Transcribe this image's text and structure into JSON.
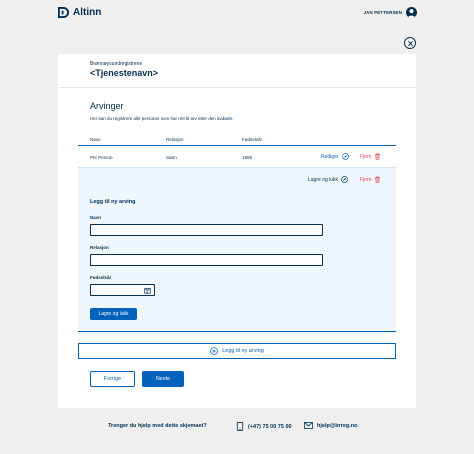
{
  "header": {
    "logo_text": "Altinn",
    "user_name": "JAN PETTERSEN"
  },
  "form": {
    "org_name": "Brønnøysundregistrene",
    "service_name": "<Tjenestenavn>",
    "section_title": "Arvinger",
    "section_description": "Her kan du registrere alle personer som har rett til arv etter den avdøde."
  },
  "table": {
    "columns": [
      "Navn",
      "Relasjon",
      "Fødselsår"
    ],
    "rows": [
      {
        "navn": "Per Person",
        "relasjon": "Sønn",
        "fodselsar": "1968",
        "edit_label": "Rediger",
        "delete_label": "Fjern"
      }
    ]
  },
  "edit_panel": {
    "save_close_label": "Lagre og lukk",
    "delete_label": "Fjern",
    "form_title": "Legg til ny arving",
    "fields": {
      "navn_label": "Navn",
      "navn_value": "",
      "relasjon_label": "Relasjon",
      "relasjon_value": "",
      "fodselsar_label": "Fødselsår",
      "fodselsar_value": ""
    },
    "save_button_label": "Lagre og lukk"
  },
  "add_button_label": "Legg til ny arving",
  "navigation": {
    "prev_label": "Forrige",
    "next_label": "Neste"
  },
  "footer": {
    "help_question": "Trenger du hjelp med dette skjemaet?",
    "phone": "(+47) 75 00 75 00",
    "email": "hjelp@brreg.no"
  },
  "colors": {
    "primary": "#0062ba",
    "dark": "#022f51",
    "danger": "#e23b53",
    "panel_bg": "#eef7fc",
    "page_bg": "#efefef"
  }
}
